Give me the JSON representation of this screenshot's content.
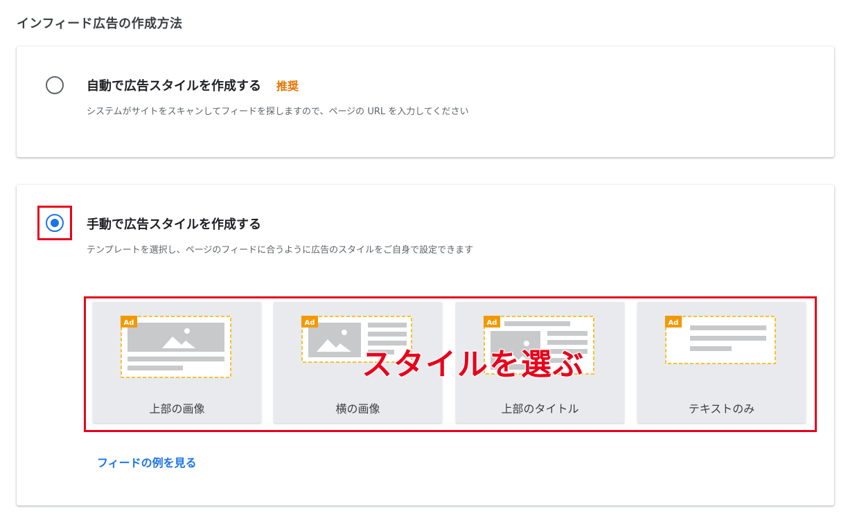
{
  "page": {
    "title": "インフィード広告の作成方法"
  },
  "auto_option": {
    "title": "自動で広告スタイルを作成する",
    "badge": "推奨",
    "description": "システムがサイトをスキャンしてフィードを探しますので、ページの URL を入力してください",
    "selected": false
  },
  "manual_option": {
    "title": "手動で広告スタイルを作成する",
    "description": "テンプレートを選択し、ページのフィードに合うように広告のスタイルをご自身で設定できます",
    "selected": true
  },
  "templates": [
    {
      "label": "上部の画像",
      "ad_tag": "Ad"
    },
    {
      "label": "横の画像",
      "ad_tag": "Ad"
    },
    {
      "label": "上部のタイトル",
      "ad_tag": "Ad"
    },
    {
      "label": "テキストのみ",
      "ad_tag": "Ad"
    }
  ],
  "annotation": {
    "text": "スタイルを選ぶ"
  },
  "feed_example_link": "フィードの例を見る",
  "colors": {
    "accent": "#1a73e8",
    "recommend": "#e37400",
    "annotation": "#e8001b",
    "ad_tag": "#f29900",
    "dashed_border": "#fbc02d"
  }
}
